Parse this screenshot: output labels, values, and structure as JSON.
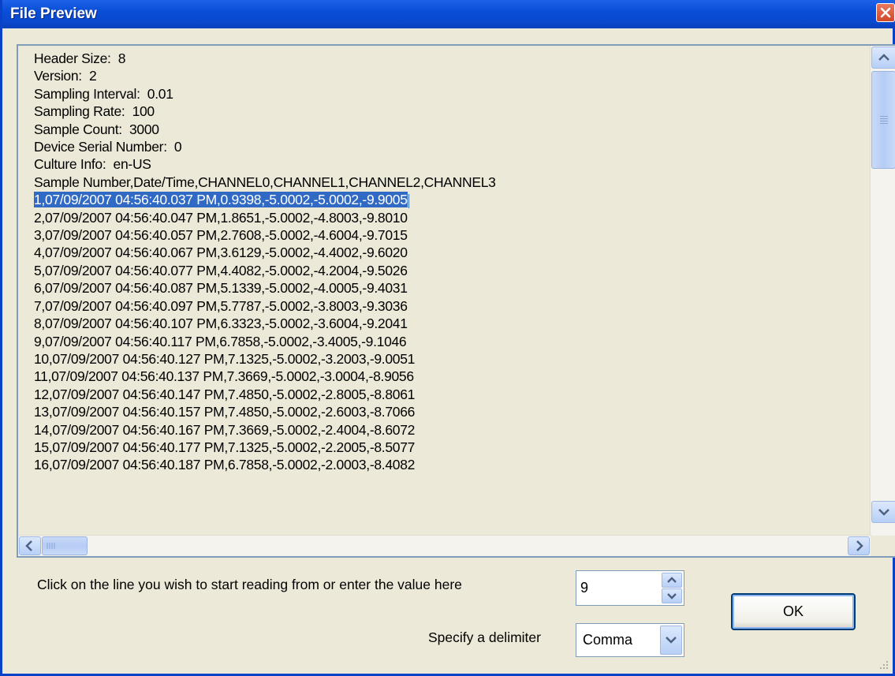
{
  "window": {
    "title": "File Preview"
  },
  "preview": {
    "lines": [
      "Header Size:  8",
      "Version:  2",
      "Sampling Interval:  0.01",
      "Sampling Rate:  100",
      "Sample Count:  3000",
      "Device Serial Number:  0",
      "Culture Info:  en-US",
      "Sample Number,Date/Time,CHANNEL0,CHANNEL1,CHANNEL2,CHANNEL3",
      "1,07/09/2007 04:56:40.037 PM,0.9398,-5.0002,-5.0002,-9.9005",
      "2,07/09/2007 04:56:40.047 PM,1.8651,-5.0002,-4.8003,-9.8010",
      "3,07/09/2007 04:56:40.057 PM,2.7608,-5.0002,-4.6004,-9.7015",
      "4,07/09/2007 04:56:40.067 PM,3.6129,-5.0002,-4.4002,-9.6020",
      "5,07/09/2007 04:56:40.077 PM,4.4082,-5.0002,-4.2004,-9.5026",
      "6,07/09/2007 04:56:40.087 PM,5.1339,-5.0002,-4.0005,-9.4031",
      "7,07/09/2007 04:56:40.097 PM,5.7787,-5.0002,-3.8003,-9.3036",
      "8,07/09/2007 04:56:40.107 PM,6.3323,-5.0002,-3.6004,-9.2041",
      "9,07/09/2007 04:56:40.117 PM,6.7858,-5.0002,-3.4005,-9.1046",
      "10,07/09/2007 04:56:40.127 PM,7.1325,-5.0002,-3.2003,-9.0051",
      "11,07/09/2007 04:56:40.137 PM,7.3669,-5.0002,-3.0004,-8.9056",
      "12,07/09/2007 04:56:40.147 PM,7.4850,-5.0002,-2.8005,-8.8061",
      "13,07/09/2007 04:56:40.157 PM,7.4850,-5.0002,-2.6003,-8.7066",
      "14,07/09/2007 04:56:40.167 PM,7.3669,-5.0002,-2.4004,-8.6072",
      "15,07/09/2007 04:56:40.177 PM,7.1325,-5.0002,-2.2005,-8.5077",
      "16,07/09/2007 04:56:40.187 PM,6.7858,-5.0002,-2.0003,-8.4082"
    ],
    "selected_line_index": 8
  },
  "start_line": {
    "prompt": "Click on the line you wish to start reading from or enter the value here",
    "value": "9"
  },
  "delimiter": {
    "label": "Specify a delimiter",
    "selected": "Comma"
  },
  "ok_label": "OK",
  "icons": [
    "close-icon",
    "scroll-up-icon",
    "scroll-down-icon",
    "scroll-left-icon",
    "scroll-right-icon",
    "spin-up-icon",
    "spin-down-icon",
    "chevron-down-icon",
    "resize-grip-icon"
  ],
  "colors": {
    "title_bar": "#0a4dd6",
    "selection": "#316ac5",
    "dialog_bg": "#ece9d8"
  }
}
